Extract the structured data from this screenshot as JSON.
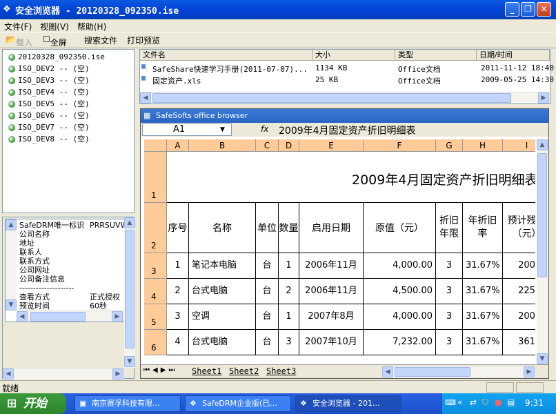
{
  "window": {
    "title": "安全浏览器 - 20120328_092350.ise"
  },
  "menu": {
    "items": [
      "文件(F)",
      "视图(V)",
      "帮助(H)"
    ]
  },
  "toolbar": {
    "load": "载入",
    "fullscreen": "全屏",
    "search": "搜索文件",
    "print": "打印预览"
  },
  "tree": {
    "items": [
      "20120328_092350.ise",
      "ISO_DEV2 -- (空)",
      "ISO_DEV3 -- (空)",
      "ISO_DEV4 -- (空)",
      "ISO_DEV5 -- (空)",
      "ISO_DEV6 -- (空)",
      "ISO_DEV7 -- (空)",
      "ISO_DEV8 -- (空)"
    ]
  },
  "info": {
    "rows": [
      {
        "label": "SafeDRM唯一标识",
        "value": "PRRSUVWX"
      },
      {
        "label": "公司名称",
        "value": ""
      },
      {
        "label": "地址",
        "value": ""
      },
      {
        "label": "联系人",
        "value": ""
      },
      {
        "label": "联系方式",
        "value": ""
      },
      {
        "label": "公司网址",
        "value": ""
      },
      {
        "label": "公司备注信息",
        "value": ""
      },
      {
        "label": "--------------------",
        "value": ""
      },
      {
        "label": "查看方式",
        "value": "正式授权"
      },
      {
        "label": "预览时间",
        "value": "60秒"
      }
    ]
  },
  "filelist": {
    "headers": [
      "文件名",
      "大小",
      "类型",
      "日期/时间"
    ],
    "rows": [
      {
        "name": "SafeShare快速学习手册(2011-07-07)...",
        "size": "1134 KB",
        "type": "Office文档",
        "date": "2011-11-12 18:40"
      },
      {
        "name": "固定资产.xls",
        "size": "25 KB",
        "type": "Office文档",
        "date": "2009-05-25 14:30"
      }
    ]
  },
  "browser": {
    "title": "SafeSofts office browser",
    "cellref": "A1",
    "fx": "fx",
    "formula": "2009年4月固定资产折旧明细表",
    "columns": [
      "A",
      "B",
      "C",
      "D",
      "E",
      "F",
      "G",
      "H",
      "I"
    ],
    "rownums": [
      "1",
      "2",
      "3",
      "4",
      "5",
      "6"
    ],
    "bigtitle": "2009年4月固定资产折旧明细表",
    "headers": [
      "序号",
      "名称",
      "单位",
      "数量",
      "启用日期",
      "原值（元）",
      "折旧年限",
      "年折旧率",
      "预计残值（元）"
    ],
    "rows": [
      [
        "1",
        "笔记本电脑",
        "台",
        "1",
        "2006年11月",
        "4,000.00",
        "3",
        "31.67%",
        "200"
      ],
      [
        "2",
        "台式电脑",
        "台",
        "2",
        "2006年11月",
        "4,500.00",
        "3",
        "31.67%",
        "225"
      ],
      [
        "3",
        "空调",
        "台",
        "1",
        "2007年8月",
        "4,000.00",
        "3",
        "31.67%",
        "200"
      ],
      [
        "4",
        "台式电脑",
        "台",
        "3",
        "2007年10月",
        "7,232.00",
        "3",
        "31.67%",
        "361"
      ]
    ],
    "sheets": [
      "Sheet1",
      "Sheet2",
      "Sheet3"
    ]
  },
  "status": {
    "text": "就绪"
  },
  "taskbar": {
    "start": "开始",
    "tasks": [
      "南京赛孚科技有限...",
      "SafeDRM企业版(已...",
      "安全浏览器 - 201..."
    ],
    "clock": "9:31"
  }
}
